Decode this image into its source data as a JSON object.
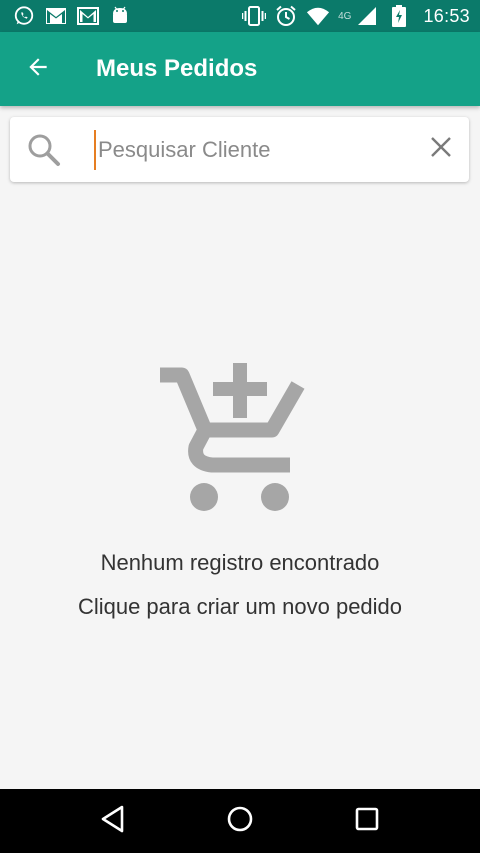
{
  "status_bar": {
    "time": "16:53",
    "network": "4G",
    "left_icons": [
      "whatsapp-icon",
      "gmail-icon",
      "gmail-icon",
      "android-icon"
    ],
    "right_icons": [
      "vibrate-icon",
      "alarm-icon",
      "wifi-icon",
      "signal-icon",
      "battery-charging-icon"
    ],
    "bg_color": "#0b7a6a"
  },
  "app_bar": {
    "title": "Meus Pedidos",
    "back_icon": "arrow-back-icon",
    "bg_color": "#14a288"
  },
  "search": {
    "placeholder": "Pesquisar Cliente",
    "value": "",
    "search_icon": "search-icon",
    "clear_icon": "close-icon"
  },
  "empty_state": {
    "icon": "add-shopping-cart-icon",
    "title": "Nenhum registro encontrado",
    "subtitle": "Clique para criar um novo pedido"
  },
  "nav_bar": {
    "buttons": [
      "back-triangle-icon",
      "home-circle-icon",
      "recents-square-icon"
    ]
  }
}
